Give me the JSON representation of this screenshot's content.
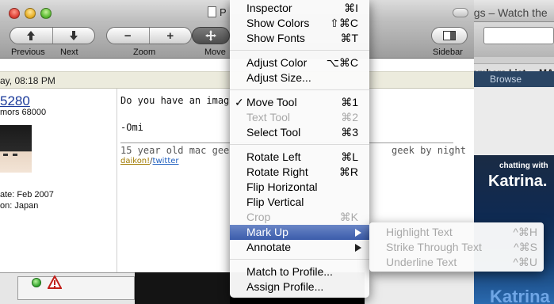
{
  "background_window": {
    "title": "ngs – Watch the",
    "links": [
      "embers List",
      "MAC"
    ],
    "browse": "Browse",
    "ad": {
      "chatting_with": "chatting with",
      "name": "Katrina.",
      "name_bottom": "Katrina"
    }
  },
  "window": {
    "title": "P",
    "toolbar": {
      "previous_label": "Previous",
      "next_label": "Next",
      "zoom_label": "Zoom",
      "move_label": "Move",
      "sidebar_label": "Sidebar",
      "zoom_out_glyph": "−",
      "zoom_in_glyph": "+"
    }
  },
  "post": {
    "date": "ay, 08:18 PM",
    "username": "5280",
    "rank": "mors 68000",
    "join": "ate: Feb 2007",
    "location": "on: Japan",
    "body": "Do you have an imag",
    "signoff": "-Omi",
    "signature": "15 year old mac gee",
    "signature_end": "geek by night",
    "sig_link1": "daikon!",
    "sig_sep": "/",
    "sig_link2": "twitter"
  },
  "menu": {
    "items": [
      {
        "label": "Inspector",
        "shortcut": "⌘I"
      },
      {
        "label": "Show Colors",
        "shortcut": "⇧⌘C"
      },
      {
        "label": "Show Fonts",
        "shortcut": "⌘T"
      },
      {
        "label": "Adjust Color",
        "shortcut": "⌥⌘C"
      },
      {
        "label": "Adjust Size...",
        "shortcut": ""
      },
      {
        "label": "Move Tool",
        "shortcut": "⌘1",
        "check": "✓"
      },
      {
        "label": "Text Tool",
        "shortcut": "⌘2"
      },
      {
        "label": "Select Tool",
        "shortcut": "⌘3"
      },
      {
        "label": "Rotate Left",
        "shortcut": "⌘L"
      },
      {
        "label": "Rotate Right",
        "shortcut": "⌘R"
      },
      {
        "label": "Flip Horizontal",
        "shortcut": ""
      },
      {
        "label": "Flip Vertical",
        "shortcut": ""
      },
      {
        "label": "Crop",
        "shortcut": "⌘K"
      },
      {
        "label": "Mark Up",
        "shortcut": ""
      },
      {
        "label": "Annotate",
        "shortcut": ""
      },
      {
        "label": "Match to Profile...",
        "shortcut": ""
      },
      {
        "label": "Assign Profile...",
        "shortcut": ""
      }
    ]
  },
  "submenu": {
    "items": [
      {
        "label": "Highlight Text",
        "shortcut": "^⌘H"
      },
      {
        "label": "Strike Through Text",
        "shortcut": "^⌘S"
      },
      {
        "label": "Underline Text",
        "shortcut": "^⌘U"
      }
    ]
  },
  "colors": {
    "menu_highlight": "#3b5cab",
    "link_blue": "#1a3a9a",
    "status_green": "#2fa32a"
  }
}
